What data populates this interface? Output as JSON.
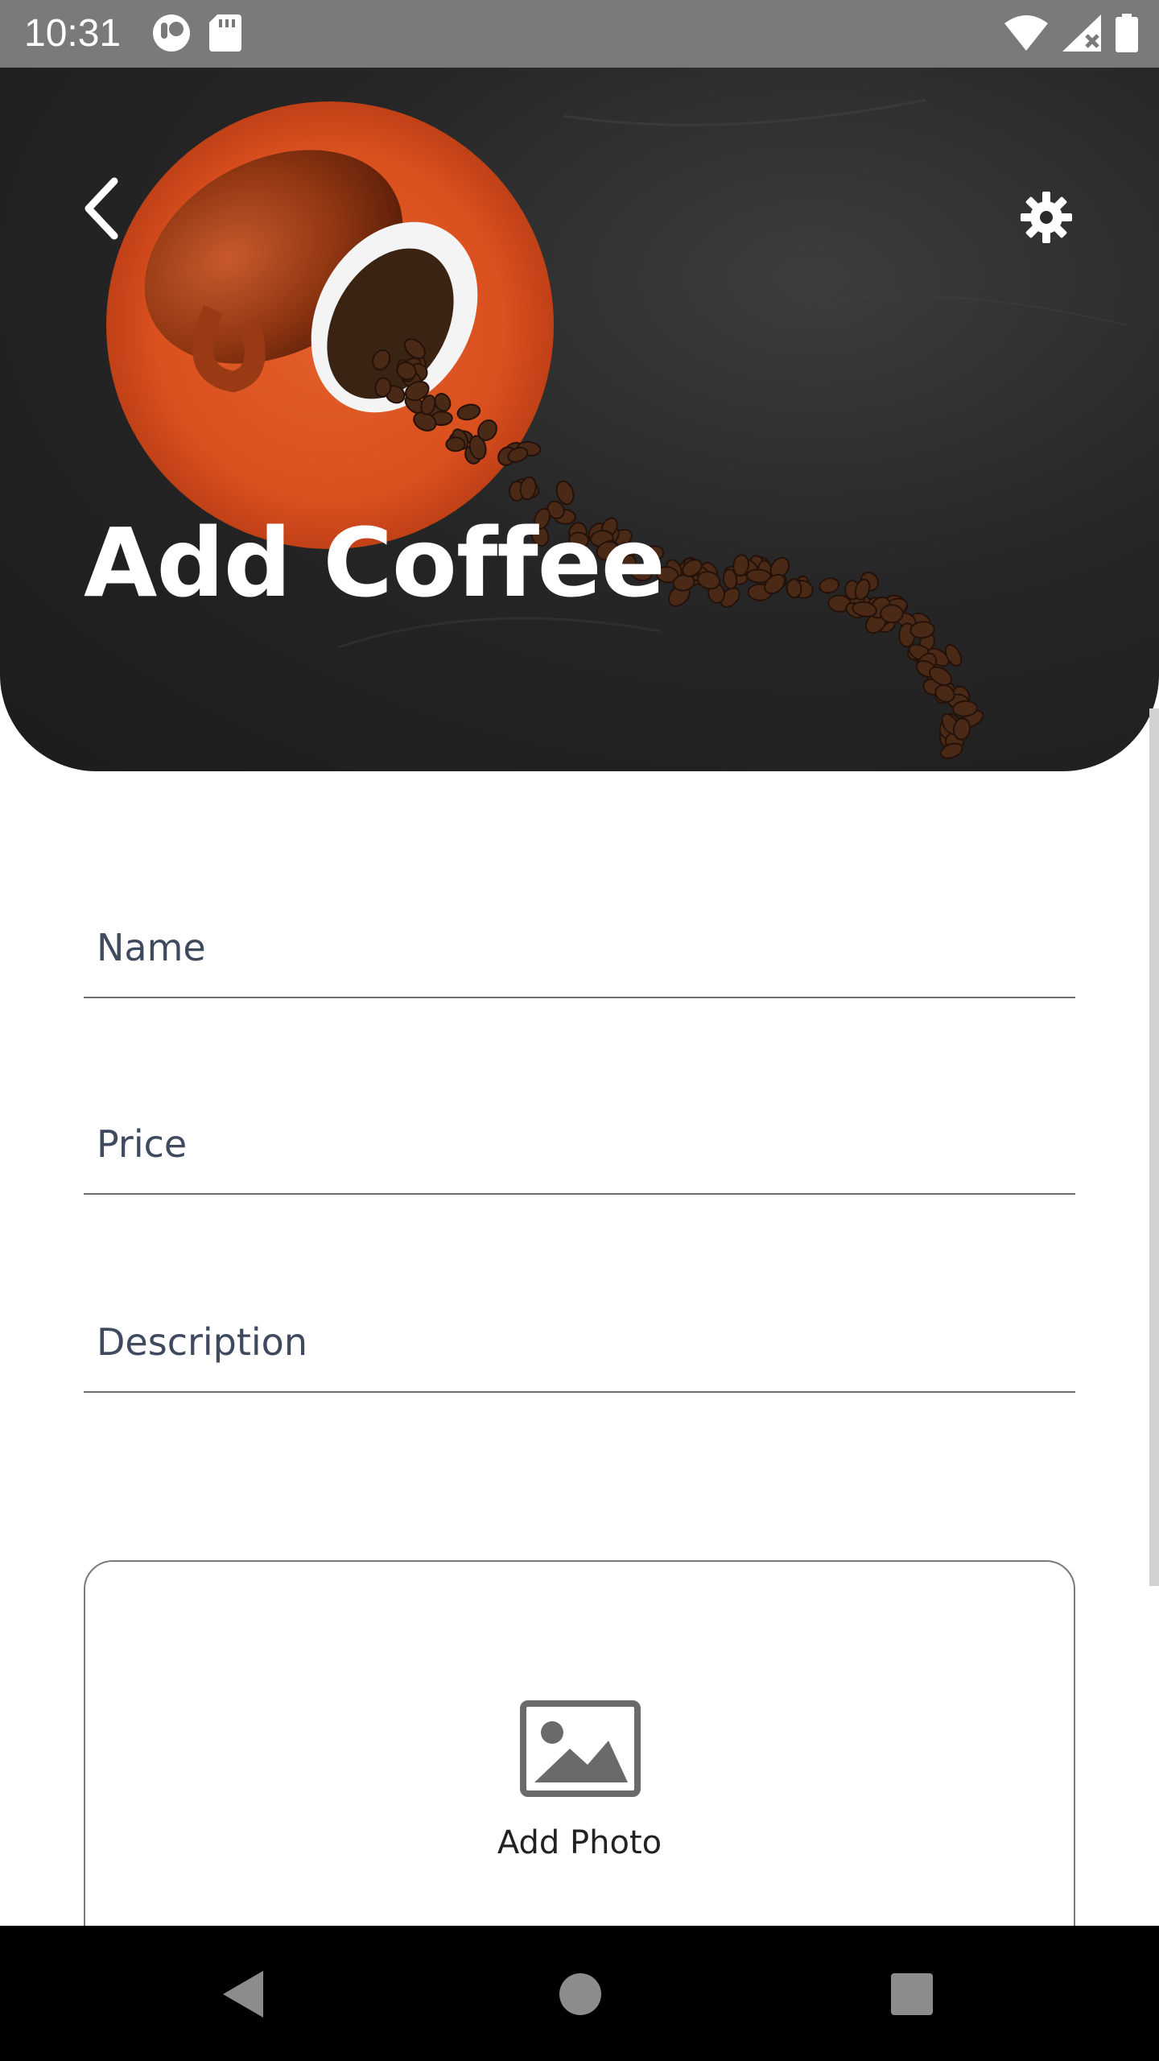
{
  "status_bar": {
    "time": "10:31",
    "left_icons": [
      "app-notification-icon",
      "sd-card-icon"
    ],
    "right_icons": [
      "wifi-icon",
      "cellular-no-signal-icon",
      "battery-icon"
    ]
  },
  "header": {
    "title": "Add Coffee",
    "back_icon": "chevron-left-icon",
    "settings_icon": "gear-icon"
  },
  "form": {
    "fields": [
      {
        "label": "Name",
        "value": ""
      },
      {
        "label": "Price",
        "value": ""
      },
      {
        "label": "Description",
        "value": ""
      }
    ],
    "photo": {
      "label": "Add Photo",
      "icon": "image-icon"
    }
  },
  "nav_bar": {
    "buttons": [
      "back-triangle-icon",
      "home-circle-icon",
      "recents-square-icon"
    ]
  },
  "colors": {
    "status_bar": "#7a7a7a",
    "label_text": "#3f4a5f",
    "cup_orange": "#d24a1c",
    "nav_bar": "#000000"
  }
}
